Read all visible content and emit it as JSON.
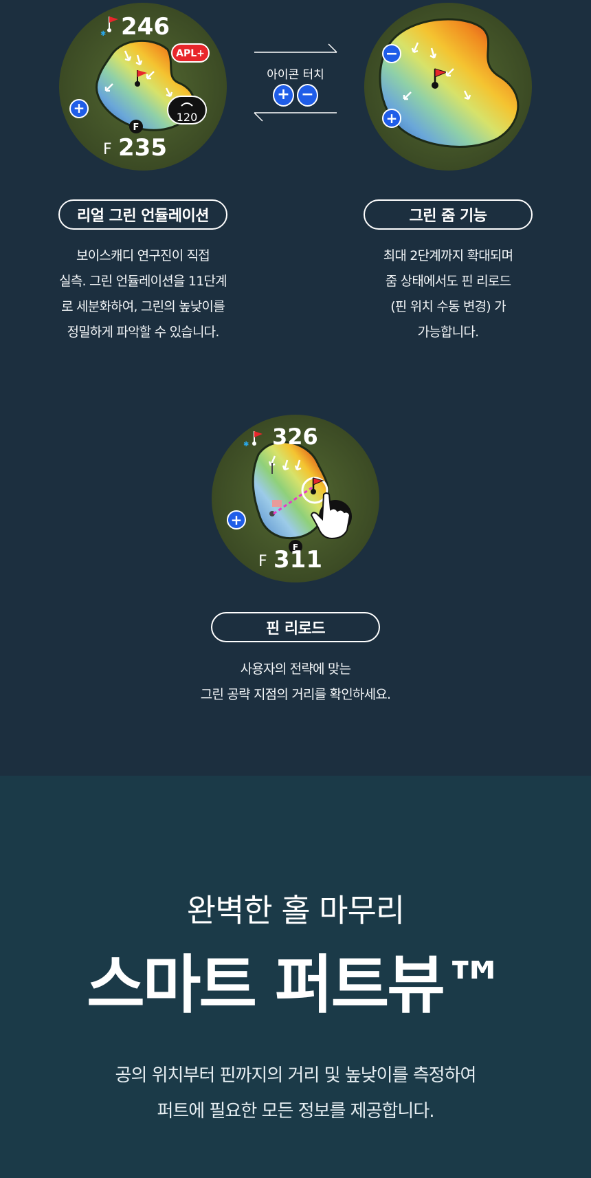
{
  "colors": {
    "bg_top": "#1c2f3f",
    "bg_bottom": "#1b3a48",
    "grass": "#4a5a2e",
    "accent_blue": "#1f5de8",
    "apl_red": "#e8262b"
  },
  "watch1": {
    "pin_distance": "246",
    "front_label": "F",
    "front_distance": "235",
    "apl_badge": "APL+",
    "layup_value": "120",
    "front_marker": "F",
    "icons": [
      "bluetooth-icon",
      "flag-icon",
      "zoom-in-icon",
      "layup-arrow-icon"
    ]
  },
  "transition": {
    "caption": "아이콘 터치",
    "icons": [
      "zoom-in-icon",
      "zoom-out-icon"
    ]
  },
  "watch2": {
    "icons": [
      "zoom-out-icon",
      "zoom-in-icon",
      "flag-icon"
    ]
  },
  "features": [
    {
      "title": "리얼 그린 언듈레이션",
      "lines": [
        "보이스캐디 연구진이 직접",
        "실측. 그린 언듈레이션을 11단계",
        "로 세분화하여, 그린의 높낮이를",
        "정밀하게 파악할 수 있습니다."
      ]
    },
    {
      "title": "그린 줌 기능",
      "lines": [
        "최대 2단계까지 확대되며",
        "줌 상태에서도 핀 리로드",
        "(핀 위치 수동 변경) 가",
        "가능합니다."
      ]
    },
    {
      "title": "핀 리로드",
      "lines": [
        "사용자의 전략에 맞는",
        "그린 공략 지점의 거리를 확인하세요."
      ]
    }
  ],
  "watch3": {
    "pin_distance": "326",
    "front_label": "F",
    "front_distance": "311",
    "front_marker": "F",
    "icons": [
      "bluetooth-icon",
      "flag-icon",
      "zoom-in-icon",
      "hand-pointer-icon"
    ]
  },
  "smart_putt": {
    "subtitle": "완벽한 홀 마무리",
    "title": "스마트 퍼트뷰™",
    "description": [
      "공의 위치부터 핀까지의 거리 및 높낮이를 측정하여",
      "퍼트에 필요한 모든 정보를 제공합니다."
    ]
  }
}
